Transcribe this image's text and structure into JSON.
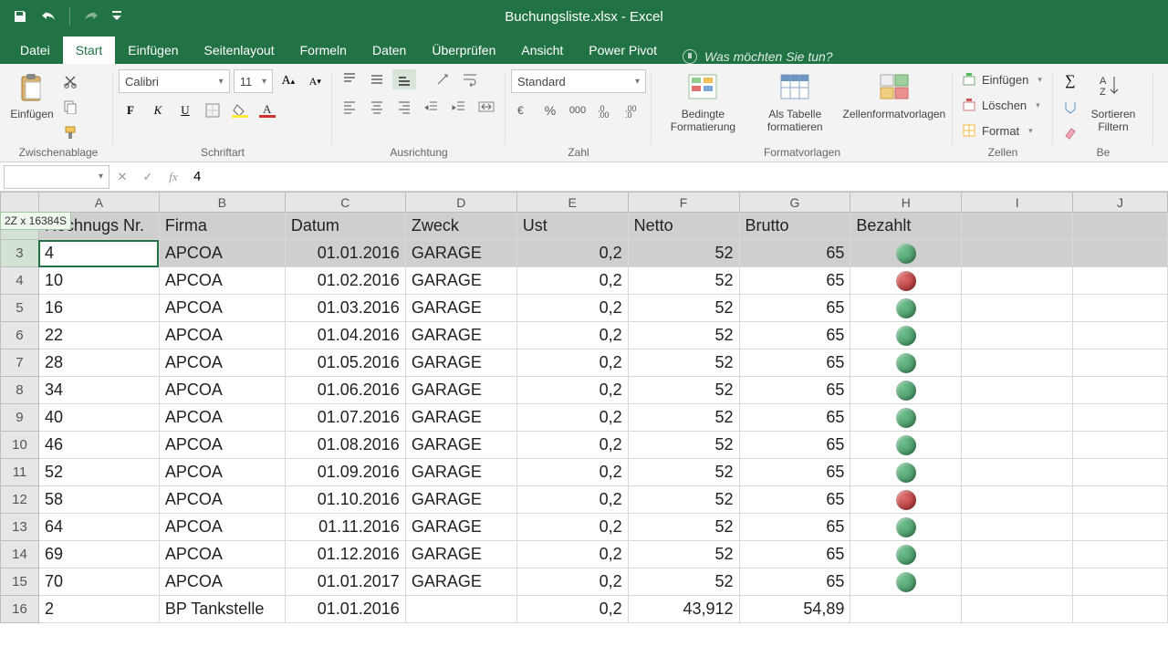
{
  "app": {
    "title": "Buchungsliste.xlsx - Excel"
  },
  "tabs": {
    "file": "Datei",
    "items": [
      "Start",
      "Einfügen",
      "Seitenlayout",
      "Formeln",
      "Daten",
      "Überprüfen",
      "Ansicht",
      "Power Pivot"
    ],
    "active": "Start",
    "tellme": "Was möchten Sie tun?"
  },
  "ribbon": {
    "clipboard": {
      "paste": "Einfügen",
      "group": "Zwischenablage"
    },
    "font": {
      "name": "Calibri",
      "size": "11",
      "group": "Schriftart"
    },
    "alignment": {
      "group": "Ausrichtung"
    },
    "number": {
      "format": "Standard",
      "group": "Zahl"
    },
    "styles": {
      "conditional": "Bedingte Formatierung",
      "astable": "Als Tabelle formatieren",
      "cellstyles": "Zellenformatvorlagen",
      "group": "Formatvorlagen"
    },
    "cells": {
      "insert": "Einfügen",
      "delete": "Löschen",
      "format": "Format",
      "group": "Zellen"
    },
    "editing": {
      "sort": "Sortieren",
      "filter": "Filtern",
      "group": "Be"
    }
  },
  "formula": {
    "namebox": "",
    "value": "4",
    "selection_info": "2Z x 16384S"
  },
  "columns": [
    "A",
    "B",
    "C",
    "D",
    "E",
    "F",
    "G",
    "H",
    "I",
    "J"
  ],
  "headers": {
    "A": "Rechnugs Nr.",
    "B": "Firma",
    "C": "Datum",
    "D": "Zweck",
    "E": "Ust",
    "F": "Netto",
    "G": "Brutto",
    "H": "Bezahlt"
  },
  "rows": [
    {
      "n": 2,
      "sel": true,
      "header": true
    },
    {
      "n": 3,
      "sel": true,
      "active": true,
      "A": "4",
      "B": "APCOA",
      "C": "01.01.2016",
      "D": "GARAGE",
      "E": "0,2",
      "F": "52",
      "G": "65",
      "H": "green"
    },
    {
      "n": 4,
      "A": "10",
      "B": "APCOA",
      "C": "01.02.2016",
      "D": "GARAGE",
      "E": "0,2",
      "F": "52",
      "G": "65",
      "H": "red"
    },
    {
      "n": 5,
      "A": "16",
      "B": "APCOA",
      "C": "01.03.2016",
      "D": "GARAGE",
      "E": "0,2",
      "F": "52",
      "G": "65",
      "H": "green"
    },
    {
      "n": 6,
      "A": "22",
      "B": "APCOA",
      "C": "01.04.2016",
      "D": "GARAGE",
      "E": "0,2",
      "F": "52",
      "G": "65",
      "H": "green"
    },
    {
      "n": 7,
      "A": "28",
      "B": "APCOA",
      "C": "01.05.2016",
      "D": "GARAGE",
      "E": "0,2",
      "F": "52",
      "G": "65",
      "H": "green"
    },
    {
      "n": 8,
      "A": "34",
      "B": "APCOA",
      "C": "01.06.2016",
      "D": "GARAGE",
      "E": "0,2",
      "F": "52",
      "G": "65",
      "H": "green"
    },
    {
      "n": 9,
      "A": "40",
      "B": "APCOA",
      "C": "01.07.2016",
      "D": "GARAGE",
      "E": "0,2",
      "F": "52",
      "G": "65",
      "H": "green"
    },
    {
      "n": 10,
      "A": "46",
      "B": "APCOA",
      "C": "01.08.2016",
      "D": "GARAGE",
      "E": "0,2",
      "F": "52",
      "G": "65",
      "H": "green"
    },
    {
      "n": 11,
      "A": "52",
      "B": "APCOA",
      "C": "01.09.2016",
      "D": "GARAGE",
      "E": "0,2",
      "F": "52",
      "G": "65",
      "H": "green"
    },
    {
      "n": 12,
      "A": "58",
      "B": "APCOA",
      "C": "01.10.2016",
      "D": "GARAGE",
      "E": "0,2",
      "F": "52",
      "G": "65",
      "H": "red"
    },
    {
      "n": 13,
      "A": "64",
      "B": "APCOA",
      "C": "01.11.2016",
      "D": "GARAGE",
      "E": "0,2",
      "F": "52",
      "G": "65",
      "H": "green"
    },
    {
      "n": 14,
      "A": "69",
      "B": "APCOA",
      "C": "01.12.2016",
      "D": "GARAGE",
      "E": "0,2",
      "F": "52",
      "G": "65",
      "H": "green"
    },
    {
      "n": 15,
      "A": "70",
      "B": "APCOA",
      "C": "01.01.2017",
      "D": "GARAGE",
      "E": "0,2",
      "F": "52",
      "G": "65",
      "H": "green"
    },
    {
      "n": 16,
      "A": "2",
      "B": "BP Tankstelle",
      "C": "01.01.2016",
      "D": "",
      "E": "0,2",
      "F": "43,912",
      "G": "54,89",
      "H": ""
    }
  ]
}
